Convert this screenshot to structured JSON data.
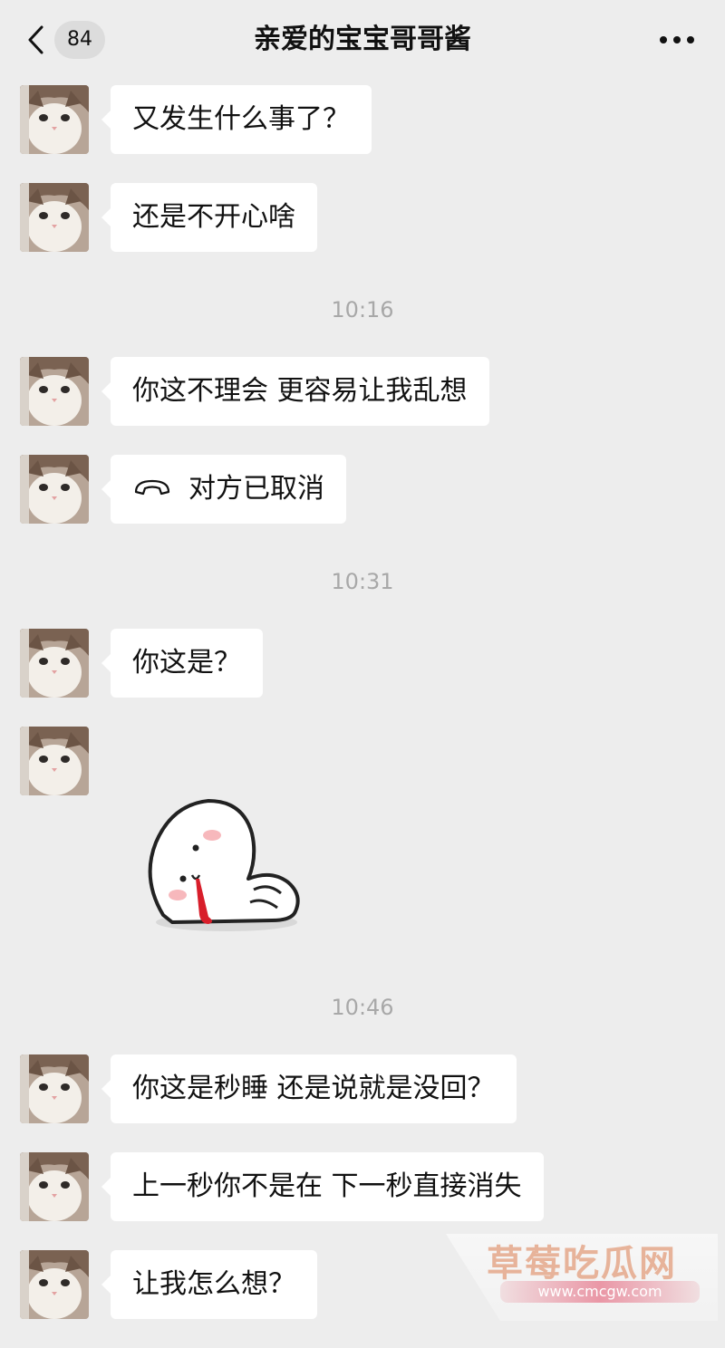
{
  "header": {
    "unread_count": "84",
    "title": "亲爱的宝宝哥哥酱",
    "back_icon": "chevron-left-icon",
    "more_icon": "more-dots-icon"
  },
  "messages": [
    {
      "text": "又发生什么事了？"
    },
    {
      "text": "还是不开心啥"
    },
    {
      "text": "你这不理会 更容易让我乱想"
    },
    {
      "text": "对方已取消",
      "icon": "phone-hangup-icon"
    },
    {
      "text": "你这是？"
    },
    {
      "text": "你这是秒睡 还是说就是没回？"
    },
    {
      "text": "上一秒你不是在 下一秒直接消失"
    },
    {
      "text": "让我怎么想？"
    }
  ],
  "timestamps": [
    "10:16",
    "10:31",
    "10:46"
  ],
  "sticker": {
    "description_icon": "bleeding-ghost-sticker"
  },
  "watermark": {
    "title": "草莓吃瓜网",
    "url": "www.cmcgw.com"
  },
  "colors": {
    "background": "#ededed",
    "bubble": "#ffffff",
    "timestamp_text": "#a8a8a8"
  }
}
